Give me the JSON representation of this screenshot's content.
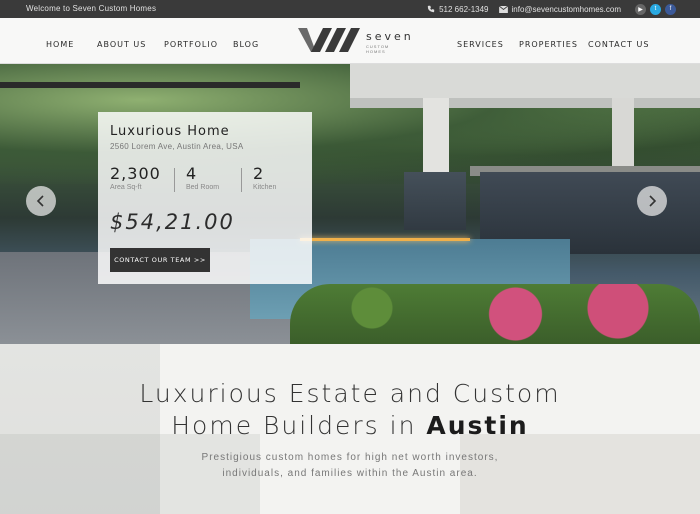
{
  "topbar": {
    "welcome": "Welcome to Seven Custom Homes",
    "phone": "512 662-1349",
    "email": "info@sevencustomhomes.com",
    "social_icons": [
      "youtube-icon",
      "twitter-icon",
      "facebook-icon"
    ],
    "social_colors": [
      "#666666",
      "#29a9e1",
      "#3b5998"
    ]
  },
  "nav": {
    "left": [
      "HOME",
      "ABOUT US",
      "PORTFOLIO",
      "BLOG"
    ],
    "right": [
      "SERVICES",
      "PROPERTIES",
      "CONTACT US"
    ],
    "logo": {
      "word": "seven",
      "sub": "CUSTOM HOMES"
    }
  },
  "hero": {
    "card": {
      "title": "Luxurious Home",
      "address": "2560 Lorem Ave, Austin Area, USA",
      "stats": [
        {
          "value": "2,300",
          "label": "Area Sq-ft"
        },
        {
          "value": "4",
          "label": "Bed Room"
        },
        {
          "value": "2",
          "label": "Kitchen"
        }
      ],
      "price": "$54,21.00",
      "cta": "CONTACT OUR TEAM >>"
    }
  },
  "intro": {
    "heading_line1": "Luxurious Estate and Custom",
    "heading_line2_prefix": "Home Builders in ",
    "heading_line2_bold": "Austin",
    "desc_line1": "Prestigious custom homes for high net worth investors,",
    "desc_line2": "individuals, and families within the Austin area."
  }
}
